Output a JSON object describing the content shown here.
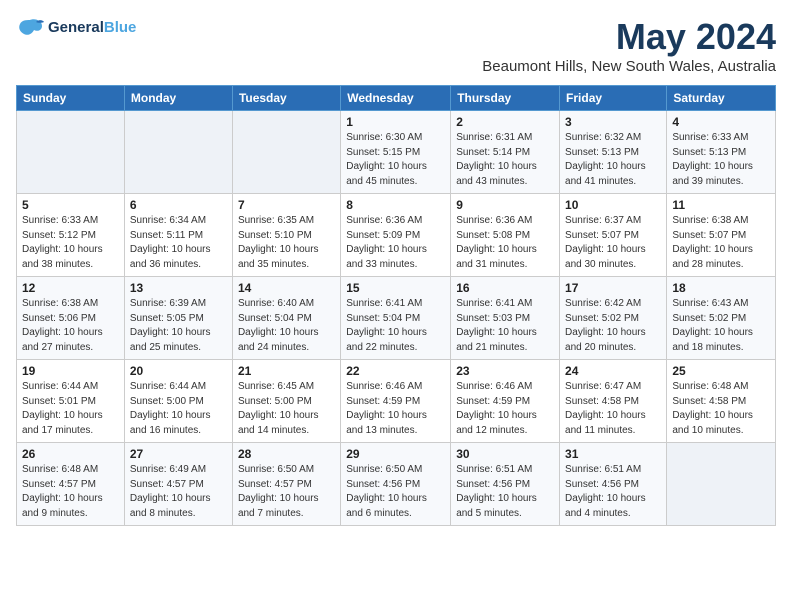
{
  "header": {
    "logo_line1": "General",
    "logo_line2": "Blue",
    "month": "May 2024",
    "location": "Beaumont Hills, New South Wales, Australia"
  },
  "weekdays": [
    "Sunday",
    "Monday",
    "Tuesday",
    "Wednesday",
    "Thursday",
    "Friday",
    "Saturday"
  ],
  "weeks": [
    [
      {
        "day": "",
        "info": ""
      },
      {
        "day": "",
        "info": ""
      },
      {
        "day": "",
        "info": ""
      },
      {
        "day": "1",
        "info": "Sunrise: 6:30 AM\nSunset: 5:15 PM\nDaylight: 10 hours\nand 45 minutes."
      },
      {
        "day": "2",
        "info": "Sunrise: 6:31 AM\nSunset: 5:14 PM\nDaylight: 10 hours\nand 43 minutes."
      },
      {
        "day": "3",
        "info": "Sunrise: 6:32 AM\nSunset: 5:13 PM\nDaylight: 10 hours\nand 41 minutes."
      },
      {
        "day": "4",
        "info": "Sunrise: 6:33 AM\nSunset: 5:13 PM\nDaylight: 10 hours\nand 39 minutes."
      }
    ],
    [
      {
        "day": "5",
        "info": "Sunrise: 6:33 AM\nSunset: 5:12 PM\nDaylight: 10 hours\nand 38 minutes."
      },
      {
        "day": "6",
        "info": "Sunrise: 6:34 AM\nSunset: 5:11 PM\nDaylight: 10 hours\nand 36 minutes."
      },
      {
        "day": "7",
        "info": "Sunrise: 6:35 AM\nSunset: 5:10 PM\nDaylight: 10 hours\nand 35 minutes."
      },
      {
        "day": "8",
        "info": "Sunrise: 6:36 AM\nSunset: 5:09 PM\nDaylight: 10 hours\nand 33 minutes."
      },
      {
        "day": "9",
        "info": "Sunrise: 6:36 AM\nSunset: 5:08 PM\nDaylight: 10 hours\nand 31 minutes."
      },
      {
        "day": "10",
        "info": "Sunrise: 6:37 AM\nSunset: 5:07 PM\nDaylight: 10 hours\nand 30 minutes."
      },
      {
        "day": "11",
        "info": "Sunrise: 6:38 AM\nSunset: 5:07 PM\nDaylight: 10 hours\nand 28 minutes."
      }
    ],
    [
      {
        "day": "12",
        "info": "Sunrise: 6:38 AM\nSunset: 5:06 PM\nDaylight: 10 hours\nand 27 minutes."
      },
      {
        "day": "13",
        "info": "Sunrise: 6:39 AM\nSunset: 5:05 PM\nDaylight: 10 hours\nand 25 minutes."
      },
      {
        "day": "14",
        "info": "Sunrise: 6:40 AM\nSunset: 5:04 PM\nDaylight: 10 hours\nand 24 minutes."
      },
      {
        "day": "15",
        "info": "Sunrise: 6:41 AM\nSunset: 5:04 PM\nDaylight: 10 hours\nand 22 minutes."
      },
      {
        "day": "16",
        "info": "Sunrise: 6:41 AM\nSunset: 5:03 PM\nDaylight: 10 hours\nand 21 minutes."
      },
      {
        "day": "17",
        "info": "Sunrise: 6:42 AM\nSunset: 5:02 PM\nDaylight: 10 hours\nand 20 minutes."
      },
      {
        "day": "18",
        "info": "Sunrise: 6:43 AM\nSunset: 5:02 PM\nDaylight: 10 hours\nand 18 minutes."
      }
    ],
    [
      {
        "day": "19",
        "info": "Sunrise: 6:44 AM\nSunset: 5:01 PM\nDaylight: 10 hours\nand 17 minutes."
      },
      {
        "day": "20",
        "info": "Sunrise: 6:44 AM\nSunset: 5:00 PM\nDaylight: 10 hours\nand 16 minutes."
      },
      {
        "day": "21",
        "info": "Sunrise: 6:45 AM\nSunset: 5:00 PM\nDaylight: 10 hours\nand 14 minutes."
      },
      {
        "day": "22",
        "info": "Sunrise: 6:46 AM\nSunset: 4:59 PM\nDaylight: 10 hours\nand 13 minutes."
      },
      {
        "day": "23",
        "info": "Sunrise: 6:46 AM\nSunset: 4:59 PM\nDaylight: 10 hours\nand 12 minutes."
      },
      {
        "day": "24",
        "info": "Sunrise: 6:47 AM\nSunset: 4:58 PM\nDaylight: 10 hours\nand 11 minutes."
      },
      {
        "day": "25",
        "info": "Sunrise: 6:48 AM\nSunset: 4:58 PM\nDaylight: 10 hours\nand 10 minutes."
      }
    ],
    [
      {
        "day": "26",
        "info": "Sunrise: 6:48 AM\nSunset: 4:57 PM\nDaylight: 10 hours\nand 9 minutes."
      },
      {
        "day": "27",
        "info": "Sunrise: 6:49 AM\nSunset: 4:57 PM\nDaylight: 10 hours\nand 8 minutes."
      },
      {
        "day": "28",
        "info": "Sunrise: 6:50 AM\nSunset: 4:57 PM\nDaylight: 10 hours\nand 7 minutes."
      },
      {
        "day": "29",
        "info": "Sunrise: 6:50 AM\nSunset: 4:56 PM\nDaylight: 10 hours\nand 6 minutes."
      },
      {
        "day": "30",
        "info": "Sunrise: 6:51 AM\nSunset: 4:56 PM\nDaylight: 10 hours\nand 5 minutes."
      },
      {
        "day": "31",
        "info": "Sunrise: 6:51 AM\nSunset: 4:56 PM\nDaylight: 10 hours\nand 4 minutes."
      },
      {
        "day": "",
        "info": ""
      }
    ]
  ]
}
